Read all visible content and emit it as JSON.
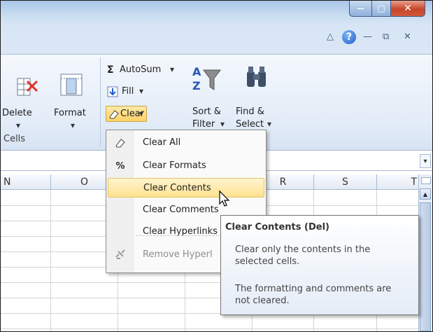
{
  "window": {
    "minimize": "—",
    "maximize": "□",
    "close": "✕"
  },
  "tabrow": {
    "minimize_ribbon": "△",
    "help": "?",
    "doc_min": "—",
    "doc_restore": "⧉",
    "doc_close": "✕"
  },
  "ribbon": {
    "delete_label": "Delete",
    "format_label": "Format",
    "cells_group": "Cells",
    "autosum_label": "AutoSum",
    "fill_label": "Fill",
    "clear_label": "Clear",
    "sort_label_1": "Sort &",
    "sort_label_2": "Filter",
    "find_label_1": "Find &",
    "find_label_2": "Select",
    "sigma": "Σ",
    "dropdown_caret": "▾"
  },
  "columns": [
    "N",
    "O",
    "",
    "",
    "R",
    "S",
    "T"
  ],
  "menu": {
    "items": [
      {
        "label": "Clear All"
      },
      {
        "label": "Clear Formats"
      },
      {
        "label": "Clear Contents"
      },
      {
        "label": "Clear Comments"
      },
      {
        "label": "Clear Hyperlinks"
      },
      {
        "label": "Remove Hyperl"
      }
    ]
  },
  "tooltip": {
    "title": "Clear Contents (Del)",
    "line1": "Clear only the contents in the",
    "line2": "selected cells.",
    "line3": "The formatting and comments are",
    "line4": "not cleared."
  },
  "colors": {
    "highlight": "#ffe18e",
    "titlebar": "#a9c6e8",
    "close": "#c7452a"
  }
}
